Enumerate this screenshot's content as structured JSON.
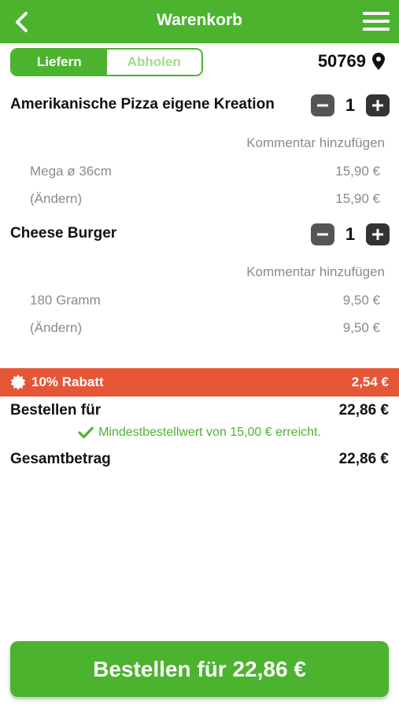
{
  "header": {
    "title": "Warenkorb",
    "back_icon": "chevron-left-icon",
    "menu_icon": "hamburger-menu-icon"
  },
  "mode_toggle": {
    "options": [
      "Liefern",
      "Abholen"
    ],
    "selected": "Liefern"
  },
  "location": {
    "postcode": "50769",
    "icon": "map-pin-icon"
  },
  "items": [
    {
      "name": "Amerikanische Pizza eigene Kreation",
      "quantity": "1",
      "comment_link": "Kommentar hinzufügen",
      "options": [
        {
          "label": "Mega ø 36cm",
          "price": "15,90 €"
        },
        {
          "label": "(Ändern)",
          "price": "15,90 €"
        }
      ]
    },
    {
      "name": "Cheese Burger",
      "quantity": "1",
      "comment_link": "Kommentar hinzufügen",
      "options": [
        {
          "label": "180 Gramm",
          "price": "9,50 €"
        },
        {
          "label": "(Ändern)",
          "price": "9,50 €"
        }
      ]
    }
  ],
  "discount": {
    "label": "10% Rabatt",
    "amount": "2,54 €",
    "icon": "discount-badge-icon"
  },
  "subtotal": {
    "label": "Bestellen für",
    "amount": "22,86 €"
  },
  "min_order_notice": "Mindestbestellwert von 15,00 € erreicht.",
  "total": {
    "label": "Gesamtbetrag",
    "amount": "22,86 €"
  },
  "order_button": "Bestellen für 22,86 €",
  "colors": {
    "brand_green": "#4cb32f",
    "discount_red": "#e55637",
    "muted_text": "#8a8a8a"
  }
}
